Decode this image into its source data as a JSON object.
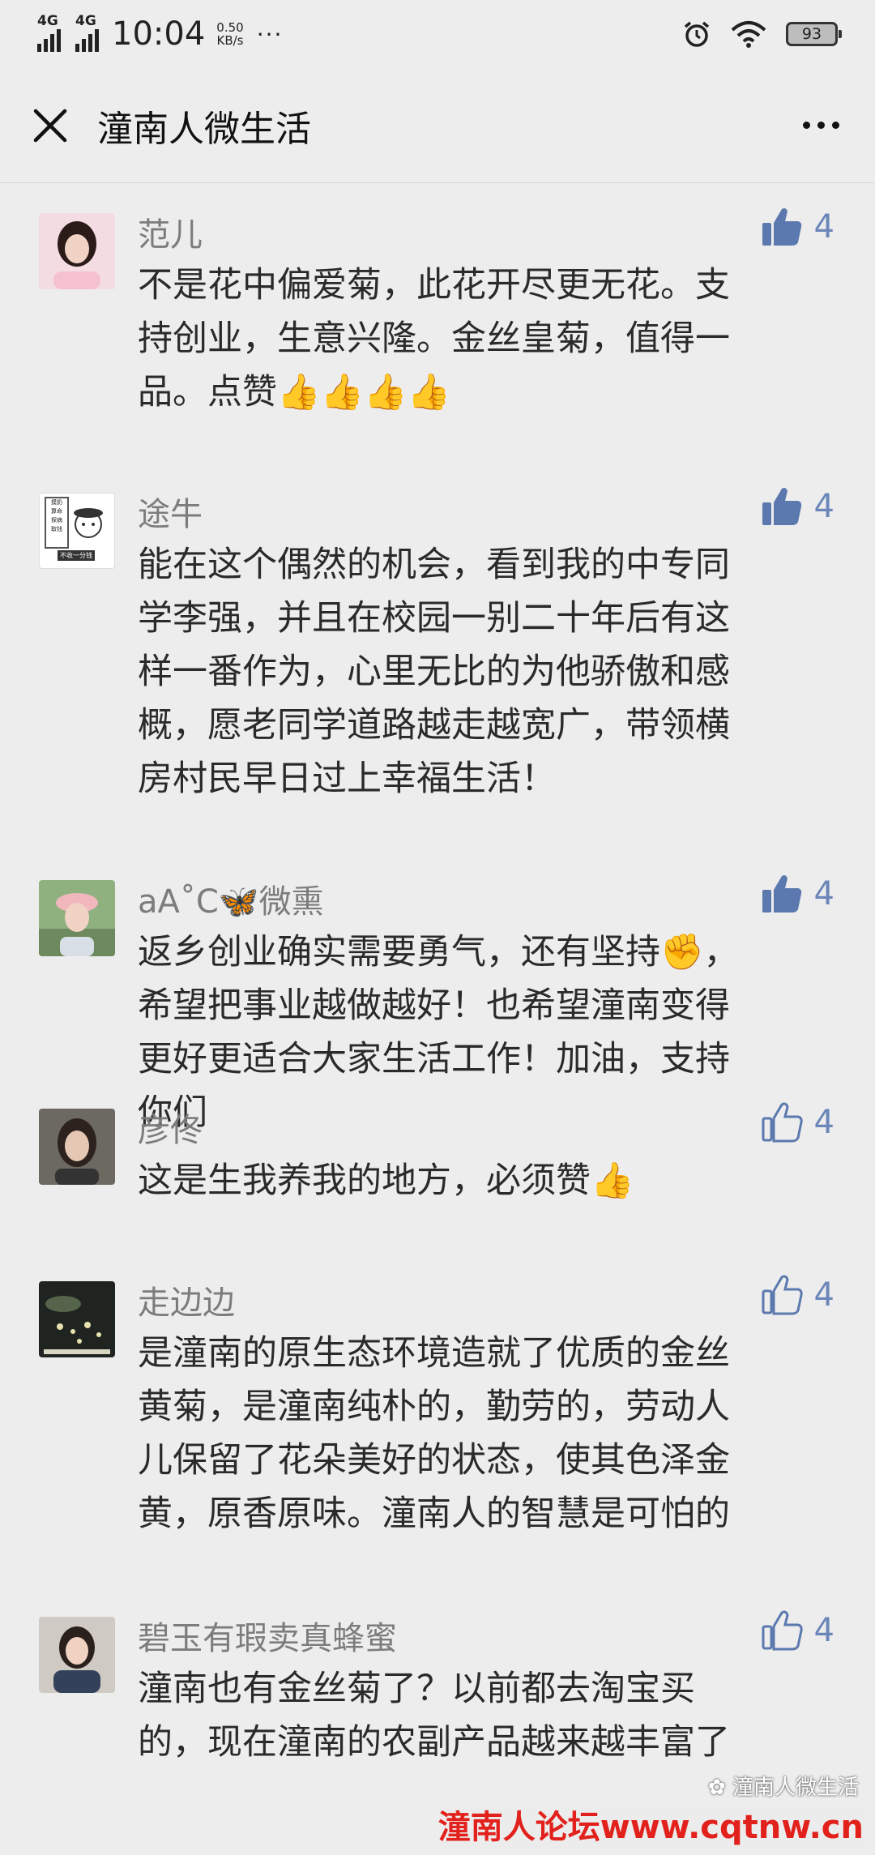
{
  "status_bar": {
    "net1": "4G",
    "net2": "4G",
    "time": "10:04",
    "speed_value": "0.50",
    "speed_unit": "KB/s",
    "more": "···",
    "battery": "93"
  },
  "header": {
    "title": "潼南人微生活"
  },
  "comments": [
    {
      "name": "范儿",
      "likes": "4",
      "liked": true,
      "lines": [
        "不是花中偏爱菊，此花开尽更无花。支",
        "持创业，生意兴隆。金丝皇菊，值得一",
        "品。点赞👍👍👍👍"
      ]
    },
    {
      "name": "途牛",
      "likes": "4",
      "liked": true,
      "avatar_text": [
        "摸奶",
        "算命",
        "探病",
        "取钱",
        "不收一分钱"
      ],
      "lines": [
        "能在这个偶然的机会，看到我的中专同",
        "学李强，并且在校园一别二十年后有这",
        "样一番作为，心里无比的为他骄傲和感",
        "概，愿老同学道路越走越宽广，带领横",
        "房村民早日过上幸福生活！"
      ]
    },
    {
      "name": "aA˚C🦋微熏",
      "likes": "4",
      "liked": true,
      "lines": [
        "返乡创业确实需要勇气，还有坚持✊，",
        "希望把事业越做越好！也希望潼南变得",
        "更好更适合大家生活工作！加油，支持",
        "你们"
      ]
    },
    {
      "name": "彦佟",
      "likes": "4",
      "liked": false,
      "lines": [
        "这是生我养我的地方，必须赞👍"
      ]
    },
    {
      "name": "走边边",
      "likes": "4",
      "liked": false,
      "lines": [
        "是潼南的原生态环境造就了优质的金丝",
        "黄菊，是潼南纯朴的，勤劳的，劳动人",
        "儿保留了花朵美好的状态，使其色泽金",
        "黄，原香原味。潼南人的智慧是可怕的"
      ]
    },
    {
      "name": "碧玉有瑕卖真蜂蜜",
      "likes": "4",
      "liked": false,
      "lines": [
        "潼南也有金丝菊了？以前都去淘宝买",
        "的，现在潼南的农副产品越来越丰富了"
      ]
    }
  ],
  "watermark": {
    "account": "潼南人微生活",
    "site": "潼南人论坛www.cqtnw.cn"
  },
  "colors": {
    "background": "#ededed",
    "like_blue": "#5b79ae",
    "name_gray": "#7c7c7c",
    "watermark_red": "#e2211c"
  }
}
